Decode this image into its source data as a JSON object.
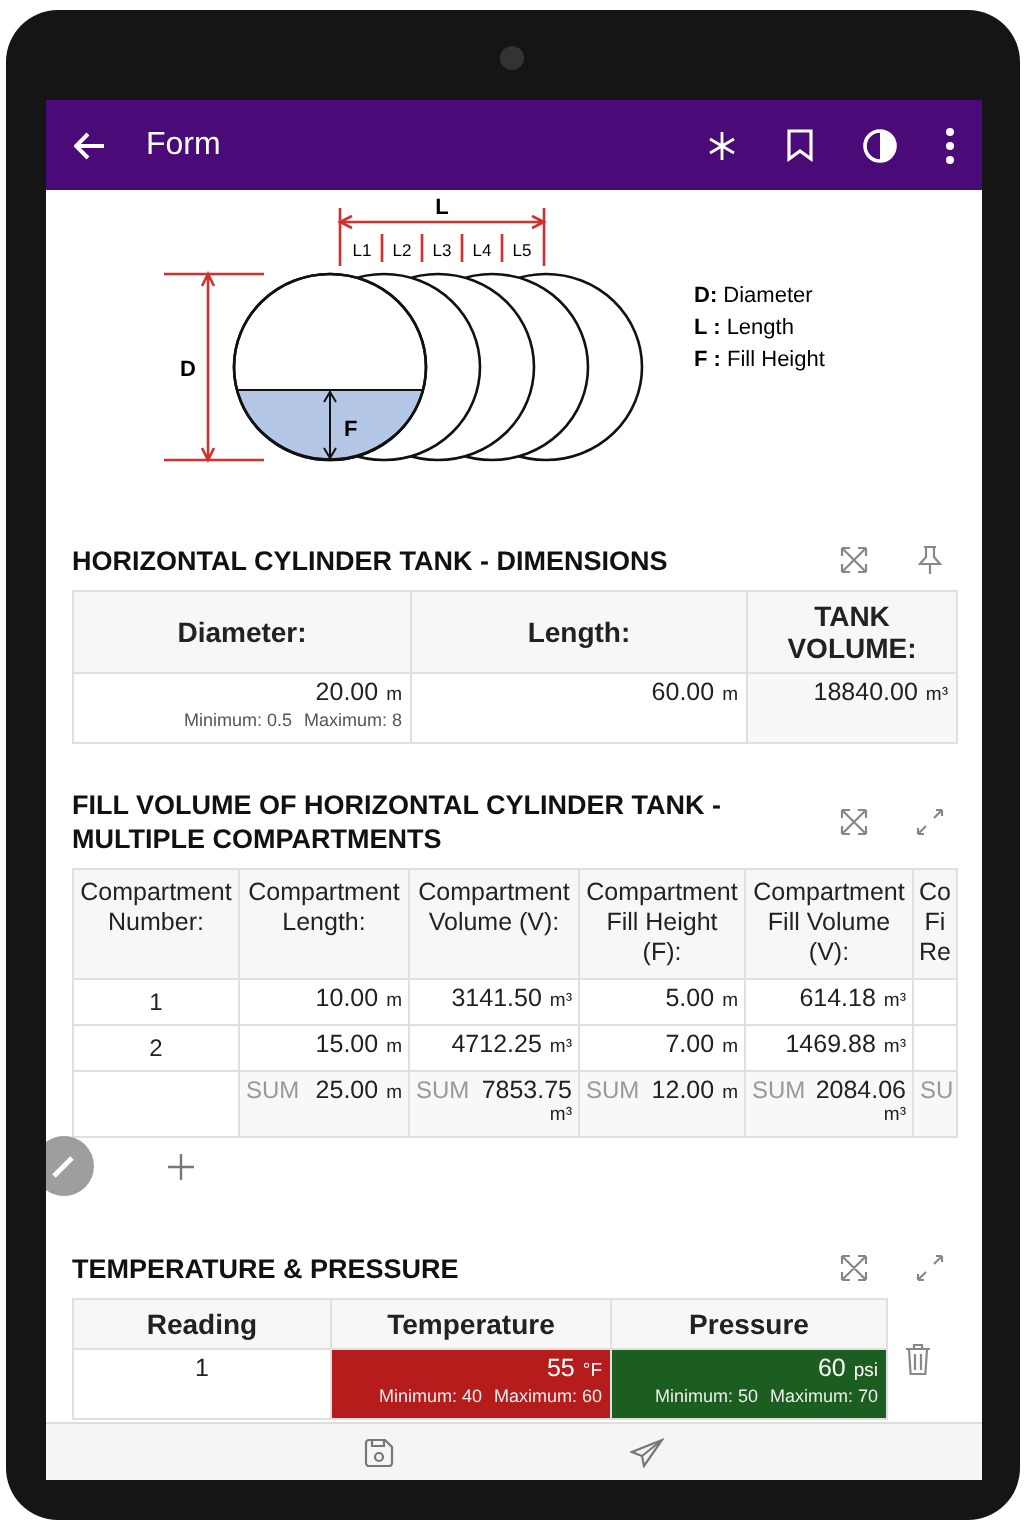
{
  "app_bar": {
    "title": "Form"
  },
  "diagram": {
    "length_label": "L",
    "segment_labels": [
      "L1",
      "L2",
      "L3",
      "L4",
      "L5"
    ],
    "diameter_label": "D",
    "fill_label": "F",
    "legend": [
      {
        "symbol": "D:",
        "label": "Diameter"
      },
      {
        "symbol": "L :",
        "label": "Length"
      },
      {
        "symbol": "F :",
        "label": "Fill Height"
      }
    ]
  },
  "dimensions": {
    "title": "HORIZONTAL CYLINDER TANK - DIMENSIONS",
    "columns": [
      "Diameter:",
      "Length:",
      "TANK VOLUME:"
    ],
    "cells": [
      {
        "value": "20.00",
        "unit": "m",
        "minimum": "Minimum: 0.5",
        "maximum": "Maximum: 8"
      },
      {
        "value": "60.00",
        "unit": "m"
      },
      {
        "value": "18840.00",
        "unit": "m³"
      }
    ]
  },
  "compartments": {
    "title": "FILL VOLUME OF HORIZONTAL CYLINDER TANK - MULTIPLE COMPARTMENTS",
    "columns": [
      "Compartment Number:",
      "Compartment Length:",
      "Compartment Volume (V):",
      "Compartment Fill Height (F):",
      "Compartment Fill Volume (V):",
      "Co Fi Re"
    ],
    "rows": [
      {
        "cells": [
          {
            "kind": "text",
            "value": "1"
          },
          {
            "value": "10.00",
            "unit": "m"
          },
          {
            "value": "3141.50",
            "unit": "m³"
          },
          {
            "value": "5.00",
            "unit": "m"
          },
          {
            "value": "614.18",
            "unit": "m³"
          }
        ]
      },
      {
        "cells": [
          {
            "kind": "text",
            "value": "2"
          },
          {
            "value": "15.00",
            "unit": "m"
          },
          {
            "value": "4712.25",
            "unit": "m³"
          },
          {
            "value": "7.00",
            "unit": "m"
          },
          {
            "value": "1469.88",
            "unit": "m³"
          }
        ]
      }
    ],
    "sum_row": [
      {
        "kind": "blank"
      },
      {
        "label": "SUM",
        "value": "25.00",
        "unit": "m"
      },
      {
        "label": "SUM",
        "value": "7853.75",
        "unit": "m³"
      },
      {
        "label": "SUM",
        "value": "12.00",
        "unit": "m"
      },
      {
        "label": "SUM",
        "value": "2084.06",
        "unit": "m³"
      },
      {
        "label": "SU"
      }
    ]
  },
  "readings": {
    "title": "TEMPERATURE & PRESSURE",
    "columns": [
      "Reading",
      "Temperature",
      "Pressure"
    ],
    "rows": [
      {
        "cells": [
          {
            "kind": "text",
            "value": "1"
          },
          {
            "value": "55",
            "unit": "°F",
            "minimum": "Minimum: 40",
            "maximum": "Maximum: 60",
            "color": "#b71c1c"
          },
          {
            "value": "60",
            "unit": "psi",
            "minimum": "Minimum: 50",
            "maximum": "Maximum: 70",
            "color": "#1b5e20"
          }
        ]
      }
    ]
  }
}
